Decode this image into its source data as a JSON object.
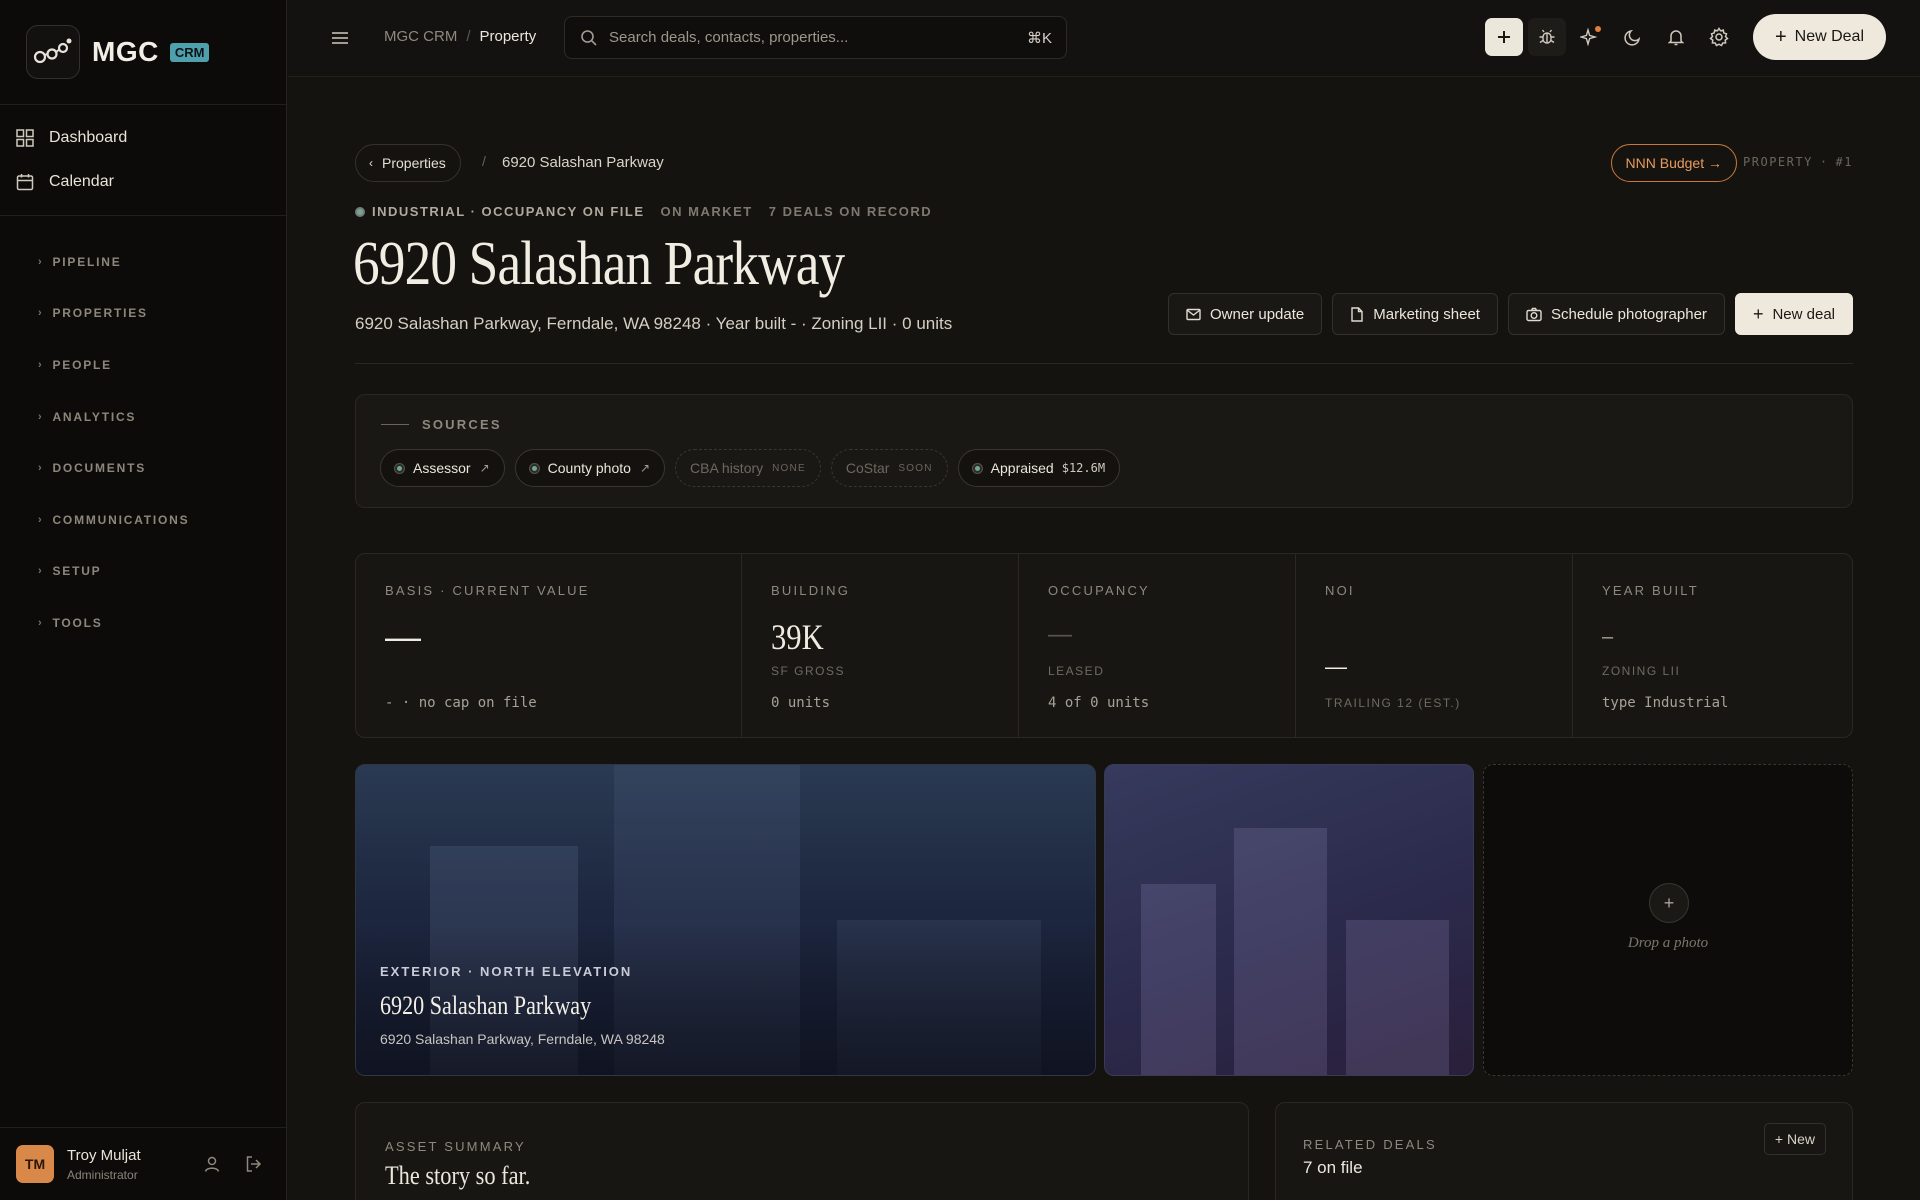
{
  "brand": {
    "name": "MGC",
    "badge": "CRM"
  },
  "nav": {
    "primary": [
      {
        "label": "Dashboard",
        "icon": "grid-icon"
      },
      {
        "label": "Calendar",
        "icon": "calendar-icon"
      }
    ],
    "sections": [
      "PIPELINE",
      "PROPERTIES",
      "PEOPLE",
      "ANALYTICS",
      "DOCUMENTS",
      "COMMUNICATIONS",
      "SETUP",
      "TOOLS"
    ]
  },
  "user": {
    "initials": "TM",
    "name": "Troy Muljat",
    "role": "Administrator"
  },
  "topbar": {
    "breadcrumb_root": "MGC CRM",
    "breadcrumb_sep": "/",
    "breadcrumb_current": "Property",
    "search_placeholder": "Search deals, contacts, properties...",
    "search_shortcut": "⌘K",
    "new_deal": "New Deal"
  },
  "page": {
    "back_label": "Properties",
    "back_sep": "/",
    "back_title": "6920 Salashan Parkway",
    "nnn_button": "NNN Budget →",
    "prop_label": "PROPERTY",
    "prop_dot": "·",
    "prop_number": "#1",
    "tag_primary": "INDUSTRIAL · OCCUPANCY ON FILE",
    "tag_market": "ON MARKET",
    "tag_deals": "7 DEALS ON RECORD",
    "title": "6920 Salashan Parkway",
    "address_line": "6920 Salashan Parkway, Ferndale, WA 98248 · Year built - · Zoning LII · 0 units",
    "actions": {
      "owner_update": "Owner update",
      "marketing_sheet": "Marketing sheet",
      "schedule_photographer": "Schedule photographer",
      "new_deal": "New deal"
    }
  },
  "sources": {
    "title": "SOURCES",
    "assessor": "Assessor",
    "county_photo": "County photo",
    "cba_history": "CBA history",
    "cba_status": "NONE",
    "costar": "CoStar",
    "costar_status": "SOON",
    "appraised": "Appraised",
    "appraised_value": "$12.6M",
    "link_arrow": "↗"
  },
  "stats": [
    {
      "label": "BASIS · CURRENT VALUE",
      "value": "—",
      "sub": "",
      "note": "- · no cap on file"
    },
    {
      "label": "BUILDING",
      "value": "39K",
      "sub": "SF GROSS",
      "note": "0 units"
    },
    {
      "label": "OCCUPANCY",
      "value": "—",
      "sub": "LEASED",
      "note": "4 of 0 units"
    },
    {
      "label": "NOI",
      "value": "—",
      "sub": "TRAILING 12 (EST.)",
      "note": ""
    },
    {
      "label": "YEAR BUILT",
      "value": "–",
      "sub": "ZONING LII",
      "note": "type Industrial"
    }
  ],
  "photos": {
    "main_label": "EXTERIOR · NORTH ELEVATION",
    "main_title": "6920 Salashan Parkway",
    "main_address": "6920 Salashan Parkway, Ferndale, WA 98248",
    "drop_plus": "+",
    "drop_text": "Drop a photo"
  },
  "summary": {
    "label": "ASSET SUMMARY",
    "heading": "The story so far."
  },
  "related": {
    "label": "RELATED DEALS",
    "count": "7 on file",
    "new_button": "+ New"
  },
  "colors": {
    "accent": "#e07e3c",
    "badge": "#4ea0ad",
    "status_dot": "#6aa89c",
    "background": "#15130f"
  }
}
